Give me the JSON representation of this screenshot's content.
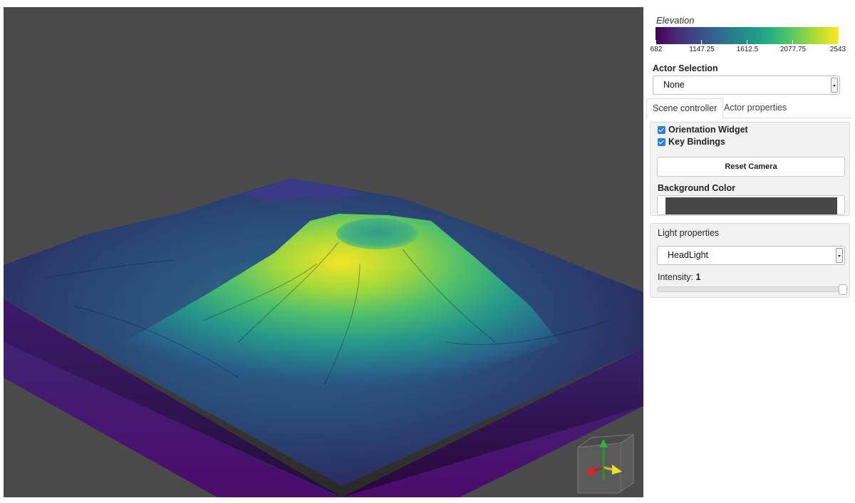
{
  "colorbar": {
    "title": "Elevation",
    "ticks": [
      "682",
      "1147.25",
      "1612.5",
      "2077.75",
      "2543"
    ]
  },
  "actor_selection": {
    "label": "Actor Selection",
    "value": "None"
  },
  "tabs": [
    {
      "label": "Scene controller",
      "active": true
    },
    {
      "label": "Actor properties",
      "active": false
    }
  ],
  "scene_controller": {
    "orientation_widget": {
      "label": "Orientation Widget",
      "checked": true
    },
    "key_bindings": {
      "label": "Key Bindings",
      "checked": true
    },
    "reset_camera_label": "Reset Camera",
    "background_color_label": "Background Color",
    "background_color": "#474747"
  },
  "light_properties": {
    "label": "Light properties",
    "light_type": "HeadLight",
    "intensity_label": "Intensity:",
    "intensity_value": "1",
    "intensity_fraction": 1.0
  },
  "colors": {
    "viewport_background": "#4a4a4a",
    "checkbox_accent": "#2f7de1",
    "colormap": "viridis"
  },
  "icons": {
    "orientation": "orientation-axes-icon",
    "select_caret": "chevron-down-icon"
  }
}
